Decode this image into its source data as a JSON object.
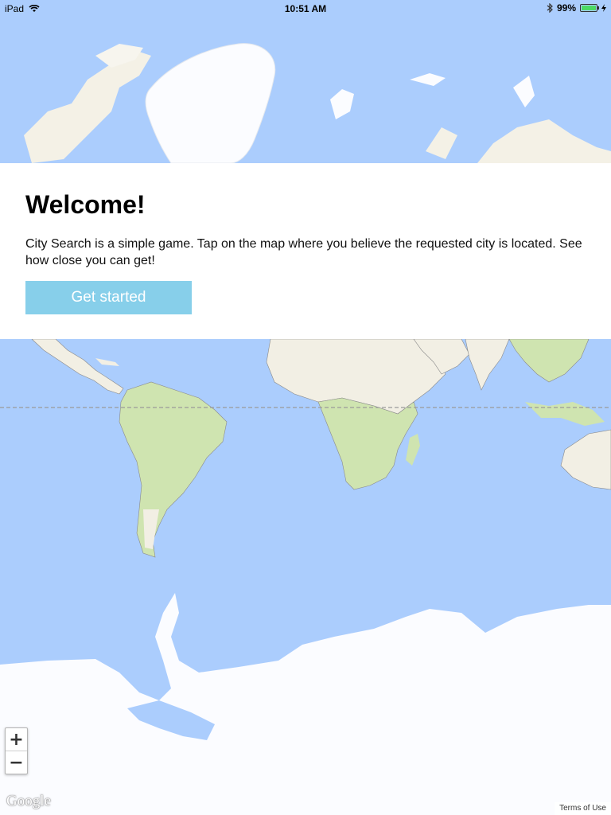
{
  "status_bar": {
    "device": "iPad",
    "time": "10:51 AM",
    "battery_percent": "99%",
    "battery_level": 0.99
  },
  "welcome": {
    "title": "Welcome!",
    "message": "City Search is a simple game. Tap on the map where you believe the requested city is located. See how close you can get!",
    "button_label": "Get started"
  },
  "map": {
    "zoom_in_label": "+",
    "zoom_out_label": "−",
    "provider_logo": "Google",
    "terms_link": "Terms of Use",
    "colors": {
      "water": "#abcdfd",
      "land": "#f2efe4",
      "vegetation": "#cfe4b0",
      "ice": "#fbfcff",
      "borders": "#8a8a8a",
      "equator": "#9a9a9a"
    }
  },
  "colors": {
    "button": "#87cfea",
    "panel": "#ffffff"
  },
  "icons": {
    "wifi": "wifi-icon",
    "bluetooth": "bluetooth-icon",
    "battery": "battery-icon",
    "charging": "charging-bolt-icon"
  }
}
